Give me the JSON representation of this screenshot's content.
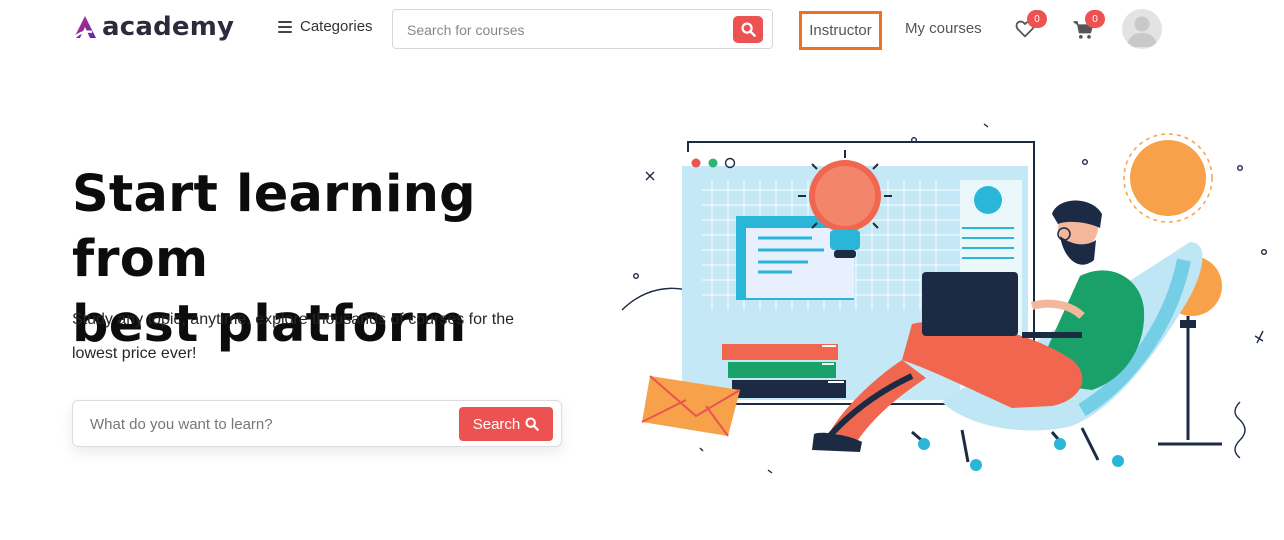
{
  "header": {
    "logo_text": "academy",
    "categories_label": "Categories",
    "search_placeholder": "Search for courses",
    "nav": {
      "instructor": "Instructor",
      "my_courses": "My courses"
    },
    "wishlist_count": "0",
    "cart_count": "0"
  },
  "hero": {
    "title_line1": "Start learning from",
    "title_line2": "best platform",
    "subtitle": "Study any topic, anytime. explore thousands of courses for the lowest price ever!",
    "search_placeholder": "What do you want to learn?",
    "search_button": "Search"
  },
  "colors": {
    "accent": "#ec5252",
    "highlight_border": "#f07020",
    "text_dark": "#0c0c0c"
  },
  "icons": [
    "hamburger-icon",
    "search-icon",
    "heart-icon",
    "cart-icon",
    "avatar-icon"
  ]
}
